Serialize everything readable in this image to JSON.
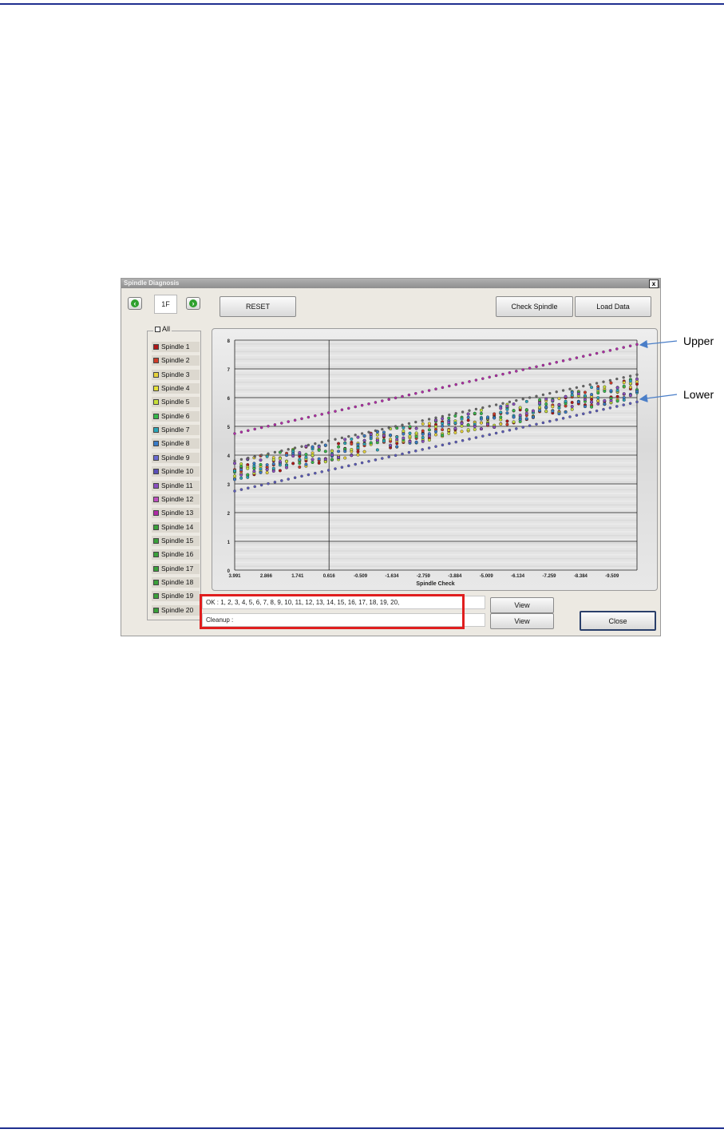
{
  "window": {
    "title": "Spindle Diagnosis",
    "close_glyph": "x",
    "prev_icon": "chevron-left-icon",
    "next_icon": "chevron-right-icon",
    "floor": "1F",
    "reset_label": "RESET",
    "check_spindle_label": "Check Spindle",
    "load_data_label": "Load Data",
    "all_label": "All",
    "spindles": [
      {
        "label": "Spindle 1",
        "color": "#b01818"
      },
      {
        "label": "Spindle 2",
        "color": "#d03c2a"
      },
      {
        "label": "Spindle 3",
        "color": "#e6d23a"
      },
      {
        "label": "Spindle 4",
        "color": "#e6e13a"
      },
      {
        "label": "Spindle 5",
        "color": "#c8e03a"
      },
      {
        "label": "Spindle 6",
        "color": "#36b84a"
      },
      {
        "label": "Spindle 7",
        "color": "#2aa6b8"
      },
      {
        "label": "Spindle 8",
        "color": "#3a7cc8"
      },
      {
        "label": "Spindle 9",
        "color": "#6a6ad0"
      },
      {
        "label": "Spindle 10",
        "color": "#5a4fb8"
      },
      {
        "label": "Spindle 11",
        "color": "#8a4fc0"
      },
      {
        "label": "Spindle 12",
        "color": "#c04fc0"
      },
      {
        "label": "Spindle 13",
        "color": "#b02aa6"
      },
      {
        "label": "Spindle 14",
        "color": "#3aa03a"
      },
      {
        "label": "Spindle 15",
        "color": "#3aa03a"
      },
      {
        "label": "Spindle 16",
        "color": "#3aa03a"
      },
      {
        "label": "Spindle 17",
        "color": "#3aa03a"
      },
      {
        "label": "Spindle 18",
        "color": "#3aa03a"
      },
      {
        "label": "Spindle 19",
        "color": "#3aa03a"
      },
      {
        "label": "Spindle 20",
        "color": "#3aa03a"
      }
    ],
    "status_ok": "OK :  1, 2, 3, 4, 5, 6, 7, 8, 9, 10, 11, 12, 13, 14, 15, 16, 17, 18, 19, 20,",
    "status_cleanup": "Cleanup :",
    "view_label": "View",
    "close_label": "Close"
  },
  "annotations": {
    "upper": "Upper",
    "lower": "Lower"
  },
  "chart_data": {
    "type": "scatter",
    "xlabel": "Spindle Check",
    "ylabel": "",
    "x_ticks": [
      "3.991",
      "2.866",
      "1.741",
      "0.616",
      "-0.509",
      "-1.634",
      "-2.759",
      "-3.884",
      "-5.009",
      "-6.134",
      "-7.259",
      "-8.384",
      "-9.509"
    ],
    "xlim": [
      3.991,
      -10.4
    ],
    "ylim": [
      0,
      8
    ],
    "y_ticks": [
      0,
      1,
      2,
      3,
      4,
      5,
      6,
      7,
      8
    ],
    "grid": true,
    "series": [
      {
        "role": "upper limit",
        "color": "#b02aa6",
        "x": [
          3.991,
          -10.4
        ],
        "y": [
          4.75,
          7.85
        ]
      },
      {
        "role": "lower limit",
        "color": "#5a5ab8",
        "x": [
          3.991,
          -10.4
        ],
        "y": [
          2.75,
          5.85
        ]
      },
      {
        "role": "upper band",
        "color": "#666666",
        "x": [
          3.991,
          -10.4
        ],
        "y": [
          3.8,
          6.8
        ]
      },
      {
        "role": "spindle measurements",
        "colors": [
          "#b01818",
          "#d03c2a",
          "#e6d23a",
          "#c8e03a",
          "#36b84a",
          "#2aa6b8",
          "#3a7cc8",
          "#8a4fc0"
        ],
        "x": [
          3.991,
          -10.4
        ],
        "y_center": [
          3.45,
          6.35
        ],
        "spread": 0.35
      }
    ]
  }
}
